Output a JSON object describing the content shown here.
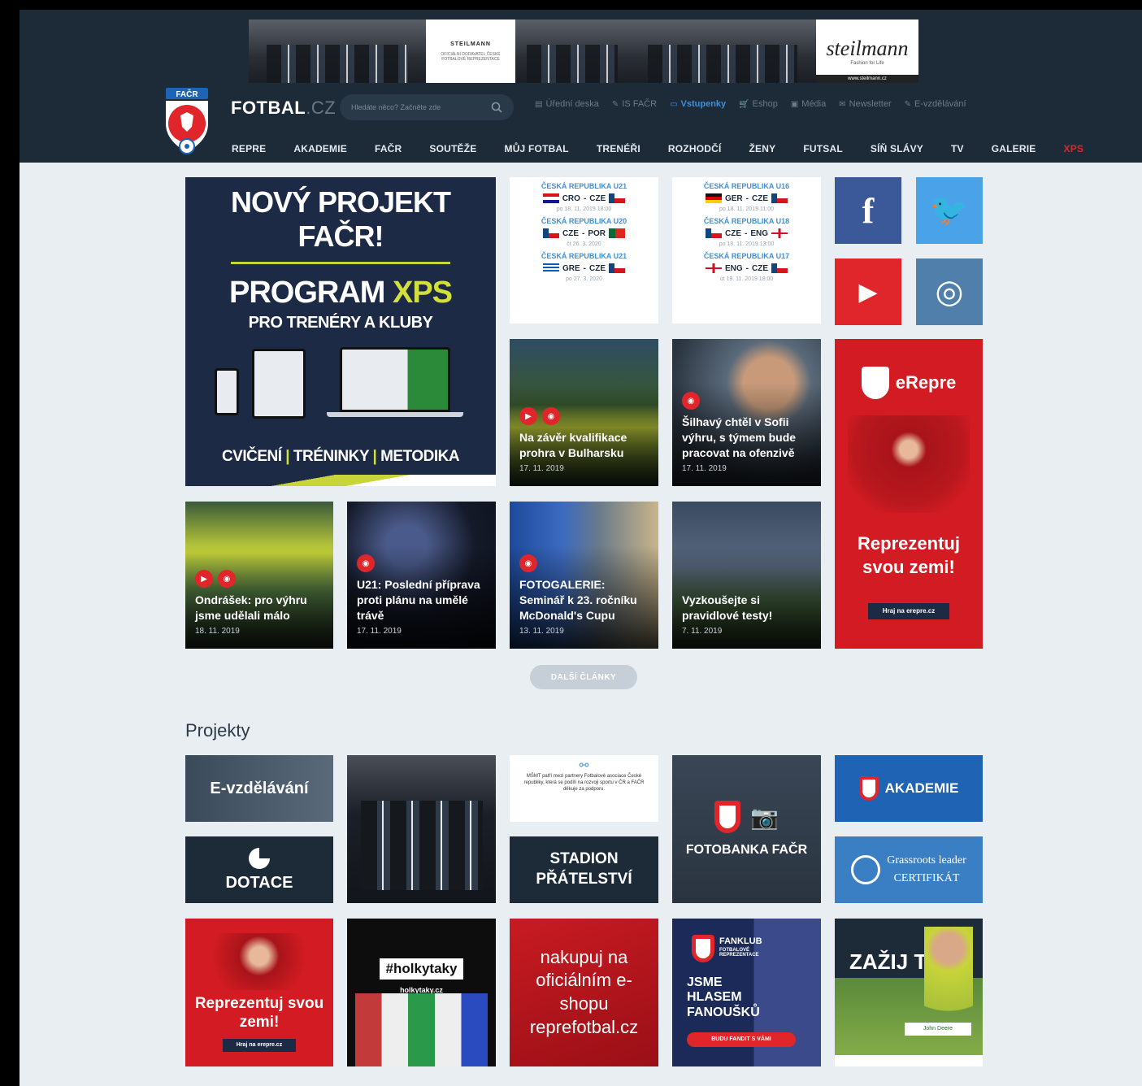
{
  "banner": {
    "center_title": "STEILMANN",
    "center_text": "OFICIÁLNÍ DODAVATEL ČESKÉ FOTBALOVÉ REPREZENTACE",
    "brand": "steilmann",
    "brand_tagline": "Fashion for Life",
    "brand_url": "www.steilmann.cz"
  },
  "header": {
    "site_name": "FOTBAL",
    "site_tld": ".CZ",
    "search_placeholder": "Hledáte něco? Začněte zde",
    "top_links": [
      {
        "label": "Úřední deska",
        "icon": "▤"
      },
      {
        "label": "IS FAČR",
        "icon": "✎"
      },
      {
        "label": "Vstupenky",
        "icon": "▭"
      },
      {
        "label": "Eshop",
        "icon": "🛒"
      },
      {
        "label": "Média",
        "icon": "▣"
      },
      {
        "label": "Newsletter",
        "icon": "✉"
      },
      {
        "label": "E-vzdělávání",
        "icon": "✎"
      }
    ],
    "nav": [
      "REPRE",
      "AKADEMIE",
      "FAČR",
      "SOUTĚŽE",
      "MŮJ FOTBAL",
      "TRENÉŘI",
      "ROZHODČÍ",
      "ŽENY",
      "FUTSAL",
      "SÍŇ SLÁVY",
      "TV",
      "GALERIE",
      "XPS"
    ]
  },
  "xps": {
    "line1": "NOVÝ PROJEKT FAČR!",
    "line2_a": "PROGRAM ",
    "line2_b": "XPS",
    "line3": "PRO TRENÉRY A KLUBY",
    "foot_a": "CVIČENÍ",
    "foot_b": "TRÉNINKY",
    "foot_c": "METODIKA",
    "sep": "|"
  },
  "fixtures_left": [
    {
      "cat": "ČESKÁ REPUBLIKA U21",
      "home": "CRO",
      "away": "CZE",
      "date": "po 18. 11. 2019 18:00"
    },
    {
      "cat": "ČESKÁ REPUBLIKA U20",
      "home": "CZE",
      "away": "POR",
      "date": "čt 26. 3. 2020"
    },
    {
      "cat": "ČESKÁ REPUBLIKA U21",
      "home": "GRE",
      "away": "CZE",
      "date": "po 27. 3. 2020"
    }
  ],
  "fixtures_right": [
    {
      "cat": "ČESKÁ REPUBLIKA U16",
      "home": "GER",
      "away": "CZE",
      "date": "po 18. 11. 2019 11:00"
    },
    {
      "cat": "ČESKÁ REPUBLIKA U18",
      "home": "CZE",
      "away": "ENG",
      "date": "po 18. 11. 2019 13:00"
    },
    {
      "cat": "ČESKÁ REPUBLIKA U17",
      "home": "ENG",
      "away": "CZE",
      "date": "út 19. 11. 2019 18:00"
    }
  ],
  "social": {
    "facebook": "f",
    "twitter": "🐦",
    "youtube": "▶",
    "instagram": "◎"
  },
  "news": [
    {
      "title": "Na závěr kvalifikace prohra v Bulharsku",
      "date": "17. 11. 2019"
    },
    {
      "title": "Šilhavý chtěl v Sofii výhru, s týmem bude pracovat na ofenzivě",
      "date": "17. 11. 2019"
    },
    {
      "title": "Ondrášek: pro výhru jsme udělali málo",
      "date": "18. 11. 2019"
    },
    {
      "title": "U21: Poslední příprava proti plánu na umělé trávě",
      "date": "17. 11. 2019"
    },
    {
      "title": "FOTOGALERIE: Seminář k 23. ročníku McDonald's Cupu",
      "date": "13. 11. 2019"
    },
    {
      "title": "Vyzkoušejte si pravidlové testy!",
      "date": "7. 11. 2019"
    }
  ],
  "erepre": {
    "brand": "eRepre",
    "slogan": "Reprezentuj svou zemi!",
    "cta": "Hraj na erepre.cz"
  },
  "more_button": "DALŠÍ ČLÁNKY",
  "projects_title": "Projekty",
  "projects": {
    "evzdelavani": "E-vzdělávání",
    "dotace": "DOTACE",
    "stadion": "STADION PŘÁTELSTVÍ",
    "fotobanka": "FOTOBANKA FAČR",
    "akademie": "AKADEMIE",
    "grassroots_a": "Grassroots leader",
    "grassroots_b": "CERTIFIKÁT",
    "holky": "#holkytaky",
    "holky_url": "holkytaky.cz",
    "eshop": "nakupuj na oficiálním e-shopu reprefotbal.cz",
    "fanklub_brand": "FANKLUB",
    "fanklub_sub": "FOTBALOVÉ REPREZENTACE",
    "fanklub_text": "JSME HLASEM FANOUŠKŮ",
    "fanklub_cta": "BUDU FANDIT S VÁMI",
    "zazij": "ZAŽIJ TO",
    "zazij_badge": "John Deere",
    "msmt": "MŠMT patří mezi partnery Fotbalové asociace České republiky, která se podílí na rozvoji sportu v ČR a FAČR děkuje za podporu."
  },
  "colors": {
    "header": "#1d2b38",
    "accent_blue": "#3f8fd9",
    "red": "#e0262b",
    "lime": "#d4e03a",
    "page_bg": "#e9eef3"
  }
}
